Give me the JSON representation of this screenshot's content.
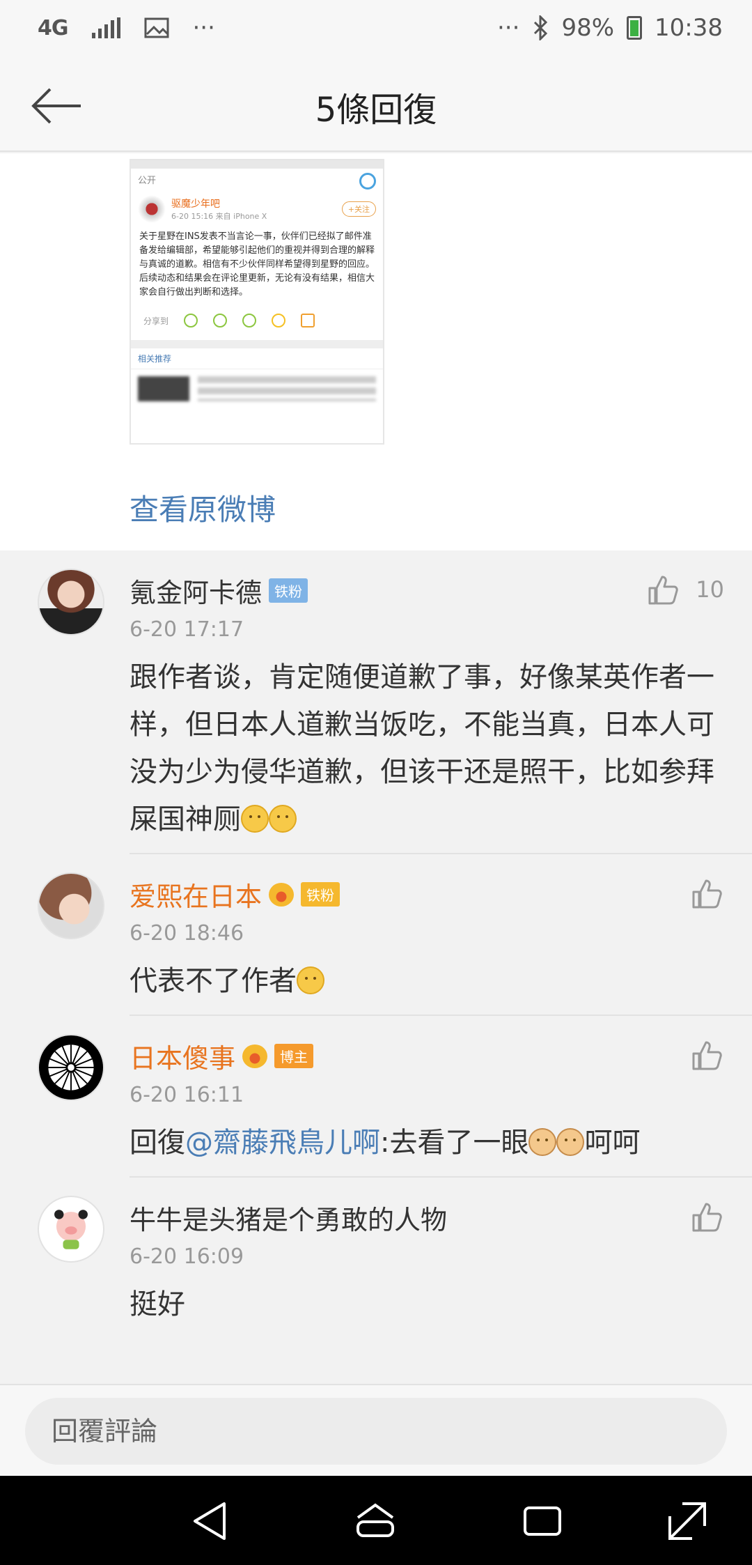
{
  "status_bar": {
    "network": "4G",
    "dots_left": "···",
    "dots_right": "···",
    "battery": "98%",
    "time": "10:38"
  },
  "header": {
    "title": "5條回復"
  },
  "post_preview": {
    "visibility": "公开",
    "username": "驱魔少年吧",
    "meta": "6-20 15:16 来自 iPhone X",
    "follow_label": "+关注",
    "body": "关于星野在INS发表不当言论一事，伙伴们已经拟了邮件准备发给编辑部，希望能够引起他们的重视并得到合理的解释与真诚的道歉。相信有不少伙伴同样希望得到星野的回应。后续动态和结果会在评论里更新，无论有没有结果，相信大家会自行做出判断和选择。",
    "share_label": "分享到",
    "related_label": "相关推荐",
    "view_original": "查看原微博"
  },
  "comments": [
    {
      "name": "氪金阿卡德",
      "badge": "铁粉",
      "time": "6-20 17:17",
      "likes": "10",
      "text": "跟作者谈，肯定随便道歉了事，好像某英作者一样，但日本人道歉当饭吃，不能当真，日本人可没为少为侵华道歉，但该干还是照干，比如参拜屎国神厕"
    },
    {
      "name": "爱熙在日本",
      "badge": "铁粉",
      "time": "6-20 18:46",
      "likes": "",
      "text": "代表不了作者"
    },
    {
      "name": "日本傻事",
      "badge": "博主",
      "time": "6-20 16:11",
      "likes": "",
      "text_prefix": "回復",
      "mention": "@齋藤飛鳥儿啊",
      "text": ":去看了一眼",
      "text_suffix": "呵呵"
    },
    {
      "name": "牛牛是头猪是个勇敢的人物",
      "badge": "",
      "time": "6-20 16:09",
      "likes": "",
      "text": "挺好"
    }
  ],
  "reply_bar": {
    "placeholder": "回覆評論"
  }
}
